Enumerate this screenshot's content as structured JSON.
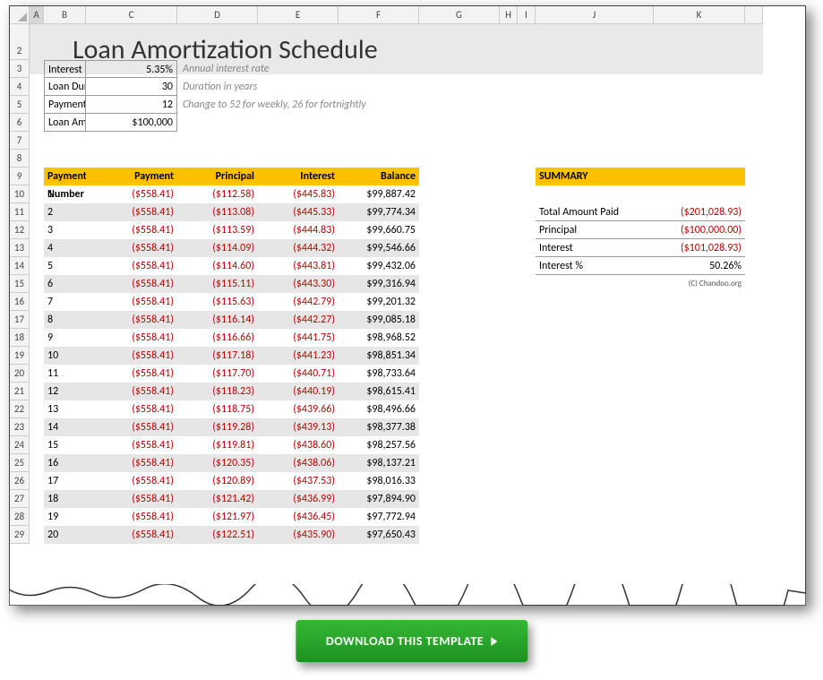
{
  "columns": [
    "A",
    "B",
    "C",
    "D",
    "E",
    "F",
    "G",
    "H",
    "I",
    "J",
    "K"
  ],
  "title": "Loan Amortization Schedule",
  "inputs": {
    "rate_label": "Interest Rate (APR)",
    "rate_value": "5.35%",
    "rate_hint": "Annual interest rate",
    "duration_label": "Loan Duration",
    "duration_value": "30",
    "duration_hint": "Duration in years",
    "ppy_label": "Payments per year",
    "ppy_value": "12",
    "ppy_hint": "Change to 52 for weekly, 26 for fortnightly",
    "amount_label": "Loan Amount",
    "amount_value": "$100,000"
  },
  "headers": {
    "pn": "Payment Number",
    "pay": "Payment",
    "prin": "Principal",
    "int": "Interest",
    "bal": "Balance",
    "summary": "SUMMARY"
  },
  "rows": [
    {
      "n": "1",
      "pay": "($558.41)",
      "prin": "($112.58)",
      "int": "($445.83)",
      "bal": "$99,887.42"
    },
    {
      "n": "2",
      "pay": "($558.41)",
      "prin": "($113.08)",
      "int": "($445.33)",
      "bal": "$99,774.34"
    },
    {
      "n": "3",
      "pay": "($558.41)",
      "prin": "($113.59)",
      "int": "($444.83)",
      "bal": "$99,660.75"
    },
    {
      "n": "4",
      "pay": "($558.41)",
      "prin": "($114.09)",
      "int": "($444.32)",
      "bal": "$99,546.66"
    },
    {
      "n": "5",
      "pay": "($558.41)",
      "prin": "($114.60)",
      "int": "($443.81)",
      "bal": "$99,432.06"
    },
    {
      "n": "6",
      "pay": "($558.41)",
      "prin": "($115.11)",
      "int": "($443.30)",
      "bal": "$99,316.94"
    },
    {
      "n": "7",
      "pay": "($558.41)",
      "prin": "($115.63)",
      "int": "($442.79)",
      "bal": "$99,201.32"
    },
    {
      "n": "8",
      "pay": "($558.41)",
      "prin": "($116.14)",
      "int": "($442.27)",
      "bal": "$99,085.18"
    },
    {
      "n": "9",
      "pay": "($558.41)",
      "prin": "($116.66)",
      "int": "($441.75)",
      "bal": "$98,968.52"
    },
    {
      "n": "10",
      "pay": "($558.41)",
      "prin": "($117.18)",
      "int": "($441.23)",
      "bal": "$98,851.34"
    },
    {
      "n": "11",
      "pay": "($558.41)",
      "prin": "($117.70)",
      "int": "($440.71)",
      "bal": "$98,733.64"
    },
    {
      "n": "12",
      "pay": "($558.41)",
      "prin": "($118.23)",
      "int": "($440.19)",
      "bal": "$98,615.41"
    },
    {
      "n": "13",
      "pay": "($558.41)",
      "prin": "($118.75)",
      "int": "($439.66)",
      "bal": "$98,496.66"
    },
    {
      "n": "14",
      "pay": "($558.41)",
      "prin": "($119.28)",
      "int": "($439.13)",
      "bal": "$98,377.38"
    },
    {
      "n": "15",
      "pay": "($558.41)",
      "prin": "($119.81)",
      "int": "($438.60)",
      "bal": "$98,257.56"
    },
    {
      "n": "16",
      "pay": "($558.41)",
      "prin": "($120.35)",
      "int": "($438.06)",
      "bal": "$98,137.21"
    },
    {
      "n": "17",
      "pay": "($558.41)",
      "prin": "($120.89)",
      "int": "($437.53)",
      "bal": "$98,016.33"
    },
    {
      "n": "18",
      "pay": "($558.41)",
      "prin": "($121.42)",
      "int": "($436.99)",
      "bal": "$97,894.90"
    },
    {
      "n": "19",
      "pay": "($558.41)",
      "prin": "($121.97)",
      "int": "($436.45)",
      "bal": "$97,772.94"
    },
    {
      "n": "20",
      "pay": "($558.41)",
      "prin": "($122.51)",
      "int": "($435.90)",
      "bal": "$97,650.43"
    }
  ],
  "summary": {
    "tap_label": "Total Amount Paid",
    "tap_value": "($201,028.93)",
    "prin_label": "Principal",
    "prin_value": "($100,000.00)",
    "int_label": "Interest",
    "int_value": "($101,028.93)",
    "pct_label": "Interest %",
    "pct_value": "50.26%",
    "credit": "(C) Chandoo.org"
  },
  "download_label": "DOWNLOAD THIS TEMPLATE"
}
